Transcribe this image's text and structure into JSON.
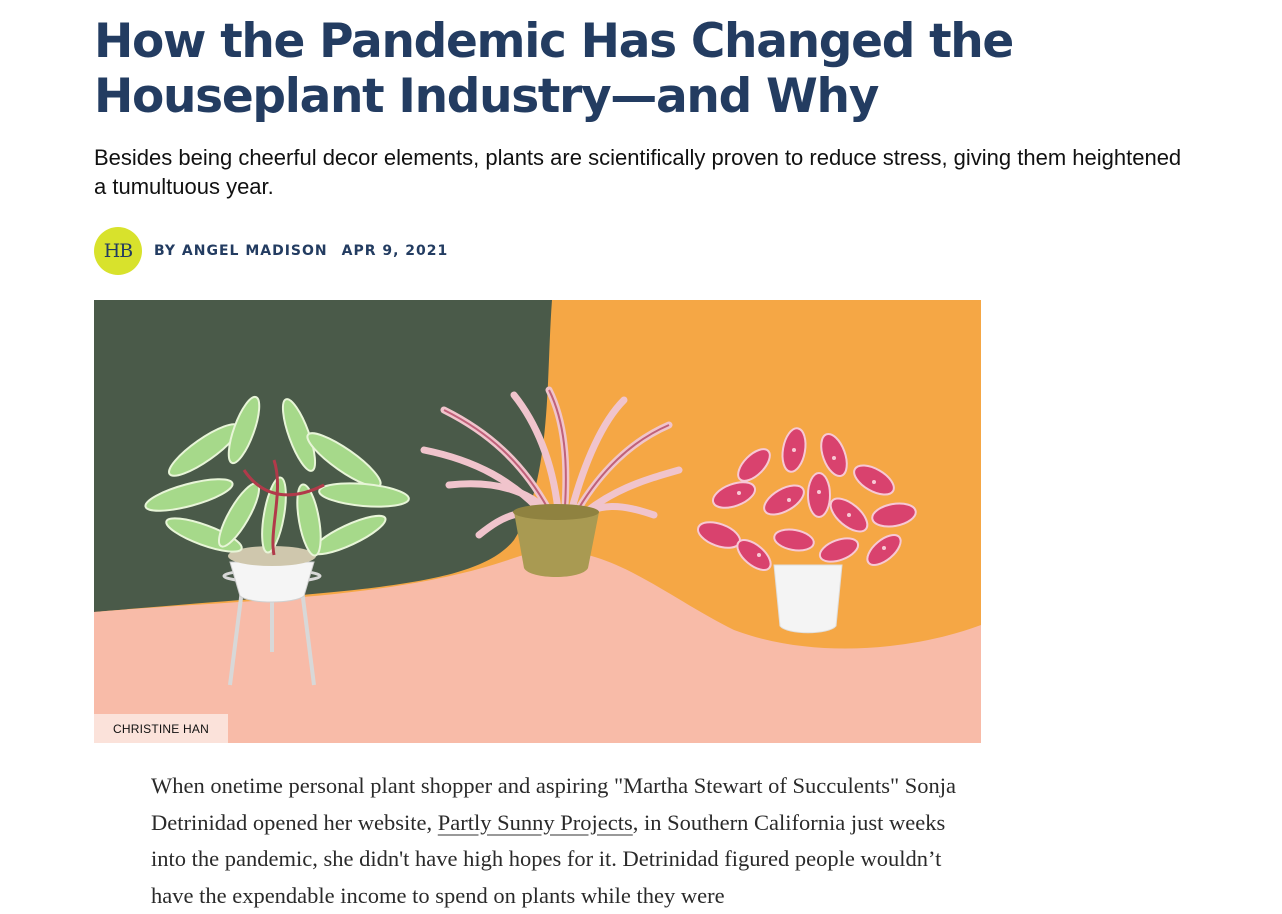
{
  "article": {
    "headline": "How the Pandemic Has Changed the Houseplant Industry—and Why",
    "dek": "Besides being cheerful decor elements, plants are scientifically proven to reduce stress, giving them heightened a tumultuous year.",
    "dek_line1": "Besides being cheerful decor elements, plants are scientifically proven to reduce stress, giving them heightened",
    "dek_line2": "a tumultuous year.",
    "byline": {
      "logo_text": "HB",
      "author": "BY ANGEL MADISON",
      "date": "APR 9, 2021"
    },
    "hero": {
      "credit": "CHRISTINE HAN",
      "icon": "houseplants-illustration"
    },
    "body": {
      "before_link": "When onetime personal plant shopper and aspiring \"Martha Stewart of Succulents\" Sonja Detrinidad opened her website, ",
      "link_text": "Partly Sunny Projects",
      "after_link": ", in Southern California just weeks into the pandemic, she didn't have high hopes for it. Detrinidad figured people wouldn’t have the expendable income to spend on plants while they were"
    }
  },
  "colors": {
    "headline": "#233c61",
    "logo_bg": "#d8e22c",
    "hero_green": "#4a5a49",
    "hero_orange": "#f5a745",
    "hero_pink": "#f8bba8"
  }
}
